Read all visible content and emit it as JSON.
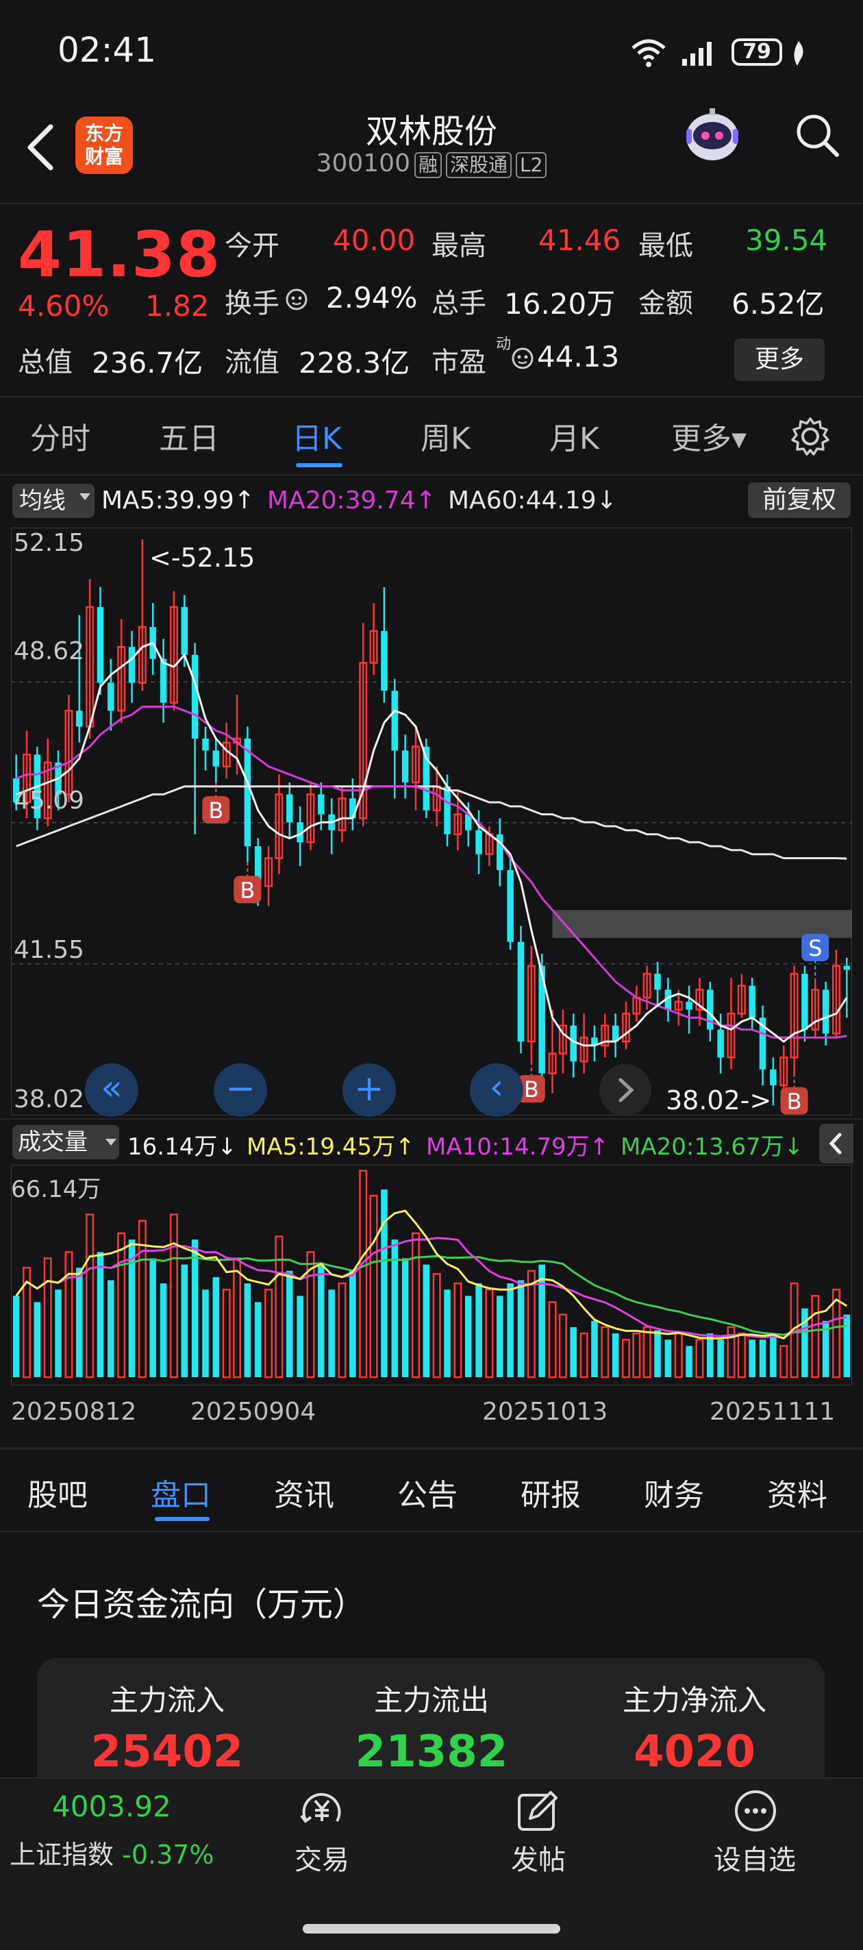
{
  "status_bar": {
    "time": "02:41",
    "battery": "79"
  },
  "header": {
    "logo_text": [
      "东方",
      "财富"
    ],
    "stock_name": "双林股份",
    "stock_code": "300100",
    "tags": [
      "融",
      "深股通",
      "L2"
    ]
  },
  "quote": {
    "price": "41.38",
    "change_pct": "4.60%",
    "change": "1.82",
    "open_label": "今开",
    "open": "40.00",
    "high_label": "最高",
    "high": "41.46",
    "low_label": "最低",
    "low": "39.54",
    "turnover_label": "换手",
    "turnover": "2.94%",
    "volume_label": "总手",
    "volume": "16.20万",
    "amount_label": "金额",
    "amount": "6.52亿",
    "mktcap_label": "总值",
    "mktcap": "236.7亿",
    "float_label": "流值",
    "float": "228.3亿",
    "pe_label": "市盈",
    "pe_sup": "动",
    "pe": "44.13",
    "more_button": "更多"
  },
  "chart_tabs": [
    {
      "label": "分时"
    },
    {
      "label": "五日"
    },
    {
      "label": "日K",
      "active": true
    },
    {
      "label": "周K"
    },
    {
      "label": "月K"
    },
    {
      "label": "更多▾"
    }
  ],
  "ma_legend": {
    "dropdown": "均线",
    "ma5": "MA5:39.99↑",
    "ma20": "MA20:39.74↑",
    "ma60": "MA60:44.19↓",
    "adjust_button": "前复权"
  },
  "colors": {
    "up": "#ff3535",
    "down": "#20e8f0",
    "ma5": "#f4f4f4",
    "ma20": "#d43cd4",
    "ma60": "#e6e6e6",
    "vol_ma5": "#f6f060",
    "vol_ma10": "#e040e0",
    "vol_ma20": "#40cc55",
    "accent": "#3d8eff"
  },
  "chart_data": {
    "type": "candlestick",
    "y_labels": [
      "52.15",
      "48.62",
      "45.09",
      "41.55",
      "38.02"
    ],
    "ylim": [
      38.02,
      52.15
    ],
    "max_annotation": "<-52.15",
    "min_annotation": "38.02->",
    "candles": [
      [
        46.2,
        45.6,
        46.8,
        45.4
      ],
      [
        45.6,
        46.8,
        47.4,
        45.2
      ],
      [
        46.8,
        45.2,
        47.0,
        44.9
      ],
      [
        45.2,
        46.6,
        47.2,
        45.0
      ],
      [
        46.6,
        45.8,
        46.9,
        45.4
      ],
      [
        45.8,
        47.9,
        48.3,
        45.6
      ],
      [
        47.9,
        47.5,
        50.3,
        47.1
      ],
      [
        47.5,
        50.5,
        51.2,
        47.2
      ],
      [
        50.5,
        48.6,
        51.0,
        48.3
      ],
      [
        48.6,
        47.9,
        49.2,
        47.4
      ],
      [
        47.9,
        49.5,
        50.2,
        47.6
      ],
      [
        49.5,
        48.6,
        49.9,
        48.1
      ],
      [
        48.6,
        50.0,
        52.2,
        48.4
      ],
      [
        50.0,
        49.2,
        50.6,
        48.8
      ],
      [
        49.2,
        48.1,
        49.7,
        47.6
      ],
      [
        48.1,
        50.5,
        50.9,
        47.9
      ],
      [
        50.5,
        49.3,
        50.8,
        49.0
      ],
      [
        49.3,
        47.2,
        49.6,
        44.8
      ],
      [
        47.2,
        46.9,
        47.5,
        46.4
      ],
      [
        46.9,
        46.5,
        47.2,
        46.1
      ],
      [
        46.5,
        47.1,
        47.6,
        46.2
      ],
      [
        47.1,
        47.2,
        48.3,
        46.3
      ],
      [
        47.2,
        44.5,
        47.5,
        44.1
      ],
      [
        44.5,
        43.5,
        44.7,
        43.0
      ],
      [
        43.5,
        44.2,
        44.5,
        43.0
      ],
      [
        44.2,
        45.8,
        46.3,
        43.8
      ],
      [
        45.8,
        45.1,
        46.1,
        44.7
      ],
      [
        45.1,
        44.6,
        45.5,
        44.0
      ],
      [
        44.6,
        45.8,
        46.1,
        44.4
      ],
      [
        45.8,
        45.3,
        46.1,
        44.9
      ],
      [
        45.3,
        44.9,
        45.7,
        44.3
      ],
      [
        44.9,
        45.7,
        46.0,
        44.6
      ],
      [
        45.7,
        45.2,
        46.2,
        44.9
      ],
      [
        45.2,
        49.1,
        50.1,
        45.0
      ],
      [
        49.1,
        49.9,
        50.6,
        48.8
      ],
      [
        49.9,
        48.4,
        51.0,
        48.1
      ],
      [
        48.4,
        46.9,
        48.7,
        45.7
      ],
      [
        46.9,
        46.1,
        47.3,
        45.7
      ],
      [
        46.1,
        47.0,
        47.5,
        45.4
      ],
      [
        47.0,
        45.4,
        47.2,
        45.2
      ],
      [
        45.4,
        46.0,
        46.5,
        45.0
      ],
      [
        46.0,
        44.8,
        46.3,
        44.5
      ],
      [
        44.8,
        45.3,
        45.9,
        44.4
      ],
      [
        45.3,
        44.9,
        45.6,
        44.5
      ],
      [
        44.9,
        44.3,
        45.4,
        43.8
      ],
      [
        44.3,
        44.8,
        45.0,
        44.0
      ],
      [
        44.8,
        43.9,
        45.2,
        43.5
      ],
      [
        43.9,
        42.1,
        44.2,
        41.9
      ],
      [
        42.1,
        39.6,
        42.5,
        39.3
      ],
      [
        39.6,
        41.5,
        42.0,
        39.1
      ],
      [
        41.5,
        38.8,
        41.8,
        38.5
      ],
      [
        38.8,
        39.3,
        40.4,
        38.3
      ],
      [
        39.3,
        40.0,
        40.4,
        38.8
      ],
      [
        40.0,
        39.1,
        40.3,
        38.7
      ],
      [
        39.1,
        39.7,
        40.3,
        38.8
      ],
      [
        39.7,
        39.5,
        40.0,
        39.1
      ],
      [
        39.5,
        40.0,
        40.3,
        39.2
      ],
      [
        40.0,
        39.6,
        40.3,
        39.2
      ],
      [
        39.6,
        40.3,
        40.6,
        39.4
      ],
      [
        40.3,
        40.7,
        41.0,
        40.1
      ],
      [
        40.7,
        41.3,
        41.5,
        40.4
      ],
      [
        41.3,
        40.9,
        41.6,
        40.5
      ],
      [
        40.9,
        40.4,
        41.2,
        40.1
      ],
      [
        40.4,
        40.6,
        40.9,
        40.0
      ],
      [
        40.6,
        40.4,
        41.0,
        39.8
      ],
      [
        40.4,
        40.9,
        41.2,
        40.0
      ],
      [
        40.9,
        39.9,
        41.1,
        39.6
      ],
      [
        39.9,
        39.2,
        40.3,
        38.8
      ],
      [
        39.2,
        40.3,
        41.2,
        38.9
      ],
      [
        40.3,
        41.0,
        41.3,
        40.2
      ],
      [
        41.0,
        40.2,
        41.2,
        39.9
      ],
      [
        40.2,
        38.9,
        40.5,
        38.5
      ],
      [
        38.9,
        38.5,
        39.2,
        38.0
      ],
      [
        38.5,
        39.2,
        39.5,
        38.2
      ],
      [
        39.2,
        41.3,
        41.5,
        38.8
      ],
      [
        41.3,
        39.9,
        41.5,
        39.6
      ],
      [
        39.9,
        40.9,
        41.1,
        39.7
      ],
      [
        40.9,
        39.8,
        41.1,
        39.5
      ],
      [
        39.8,
        41.5,
        41.9,
        39.7
      ],
      [
        41.5,
        41.4,
        41.7,
        40.2
      ]
    ],
    "ma5": [
      45.8,
      45.9,
      46.0,
      46.1,
      46.2,
      46.4,
      46.7,
      47.5,
      48.5,
      48.8,
      49.0,
      49.2,
      49.5,
      49.6,
      49.1,
      49.0,
      49.3,
      48.6,
      47.7,
      47.2,
      46.9,
      46.7,
      46.1,
      45.4,
      45.0,
      44.8,
      44.7,
      44.8,
      45.0,
      45.1,
      45.1,
      45.2,
      45.2,
      45.9,
      46.9,
      47.6,
      47.9,
      47.8,
      47.5,
      46.7,
      46.4,
      46.0,
      45.7,
      45.4,
      45.0,
      44.8,
      44.6,
      44.3,
      43.6,
      42.4,
      41.3,
      40.2,
      39.8,
      39.6,
      39.5,
      39.5,
      39.6,
      39.6,
      39.8,
      40.0,
      40.3,
      40.5,
      40.7,
      40.8,
      40.7,
      40.5,
      40.3,
      40.0,
      39.9,
      40.1,
      40.2,
      40.0,
      39.8,
      39.6,
      39.8,
      39.9,
      40.1,
      40.2,
      40.3,
      40.7
    ],
    "ma20": [
      46.2,
      46.3,
      46.3,
      46.4,
      46.5,
      46.6,
      46.8,
      47.0,
      47.3,
      47.5,
      47.7,
      47.8,
      48.0,
      48.0,
      48.0,
      48.0,
      47.9,
      47.8,
      47.6,
      47.4,
      47.3,
      47.1,
      46.9,
      46.7,
      46.5,
      46.4,
      46.3,
      46.2,
      46.1,
      46.0,
      46.0,
      45.9,
      45.9,
      45.9,
      46.0,
      46.0,
      46.0,
      46.0,
      46.0,
      45.9,
      45.8,
      45.6,
      45.5,
      45.3,
      45.1,
      44.8,
      44.6,
      44.2,
      43.9,
      43.6,
      43.2,
      42.9,
      42.6,
      42.3,
      42.0,
      41.7,
      41.4,
      41.1,
      40.9,
      40.7,
      40.6,
      40.5,
      40.4,
      40.3,
      40.2,
      40.2,
      40.1,
      40.0,
      40.0,
      39.9,
      39.9,
      39.8,
      39.7,
      39.7,
      39.7,
      39.7,
      39.7,
      39.7,
      39.7,
      39.74
    ],
    "ma60": [
      44.5,
      44.6,
      44.7,
      44.8,
      44.9,
      45.0,
      45.1,
      45.2,
      45.3,
      45.4,
      45.5,
      45.6,
      45.7,
      45.8,
      45.8,
      45.9,
      46.0,
      46.0,
      46.0,
      46.0,
      46.0,
      46.0,
      46.0,
      46.0,
      46.0,
      46.0,
      46.0,
      46.0,
      46.0,
      46.0,
      46.0,
      46.0,
      46.0,
      46.0,
      46.0,
      46.0,
      46.0,
      46.0,
      46.0,
      46.0,
      46.0,
      45.9,
      45.9,
      45.8,
      45.7,
      45.6,
      45.6,
      45.5,
      45.5,
      45.4,
      45.3,
      45.3,
      45.2,
      45.2,
      45.1,
      45.1,
      45.0,
      45.0,
      44.9,
      44.9,
      44.8,
      44.8,
      44.7,
      44.7,
      44.6,
      44.6,
      44.5,
      44.5,
      44.4,
      44.4,
      44.3,
      44.3,
      44.3,
      44.2,
      44.2,
      44.2,
      44.2,
      44.2,
      44.2,
      44.19
    ],
    "markers": [
      {
        "type": "B",
        "i": 19
      },
      {
        "type": "B",
        "i": 22
      },
      {
        "type": "B",
        "i": 49
      },
      {
        "type": "B",
        "i": 74
      },
      {
        "type": "S",
        "i": 76
      }
    ],
    "volume_legend": {
      "dropdown": "成交量",
      "vol": "16.14万↓",
      "ma5": "MA5:19.45万↑",
      "ma10": "MA10:14.79万↑",
      "ma20": "MA20:13.67万↓"
    },
    "volume_max_label": "66.14万",
    "volume": [
      26,
      35,
      24,
      38,
      28,
      40,
      35,
      52,
      40,
      31,
      46,
      44,
      50,
      38,
      30,
      52,
      36,
      44,
      28,
      32,
      28,
      38,
      30,
      24,
      28,
      45,
      34,
      26,
      40,
      36,
      28,
      30,
      34,
      66,
      58,
      60,
      44,
      38,
      46,
      36,
      33,
      28,
      30,
      26,
      30,
      28,
      26,
      30,
      31,
      34,
      36,
      24,
      20,
      16,
      14,
      18,
      16,
      14,
      12,
      14,
      16,
      15,
      12,
      14,
      10,
      12,
      14,
      12,
      16,
      14,
      12,
      12,
      14,
      10,
      30,
      22,
      26,
      18,
      28,
      20
    ],
    "dates": [
      "20250812",
      "20250904",
      "20251013",
      "20251111"
    ]
  },
  "overlay_buttons": [
    "«",
    "−",
    "+",
    "‹"
  ],
  "bottom_tabs": [
    {
      "label": "股吧"
    },
    {
      "label": "盘口",
      "active": true
    },
    {
      "label": "资讯"
    },
    {
      "label": "公告"
    },
    {
      "label": "研报"
    },
    {
      "label": "财务"
    },
    {
      "label": "资料"
    }
  ],
  "fund_flow": {
    "title": "今日资金流向（万元）",
    "inflow_label": "主力流入",
    "inflow": "25402",
    "outflow_label": "主力流出",
    "outflow": "21382",
    "net_label": "主力净流入",
    "net": "4020"
  },
  "bottom_nav": {
    "index_value": "4003.92",
    "index_label": "上证指数",
    "index_change": "-0.37%",
    "trade": "交易",
    "post": "发帖",
    "watchlist": "设自选"
  }
}
